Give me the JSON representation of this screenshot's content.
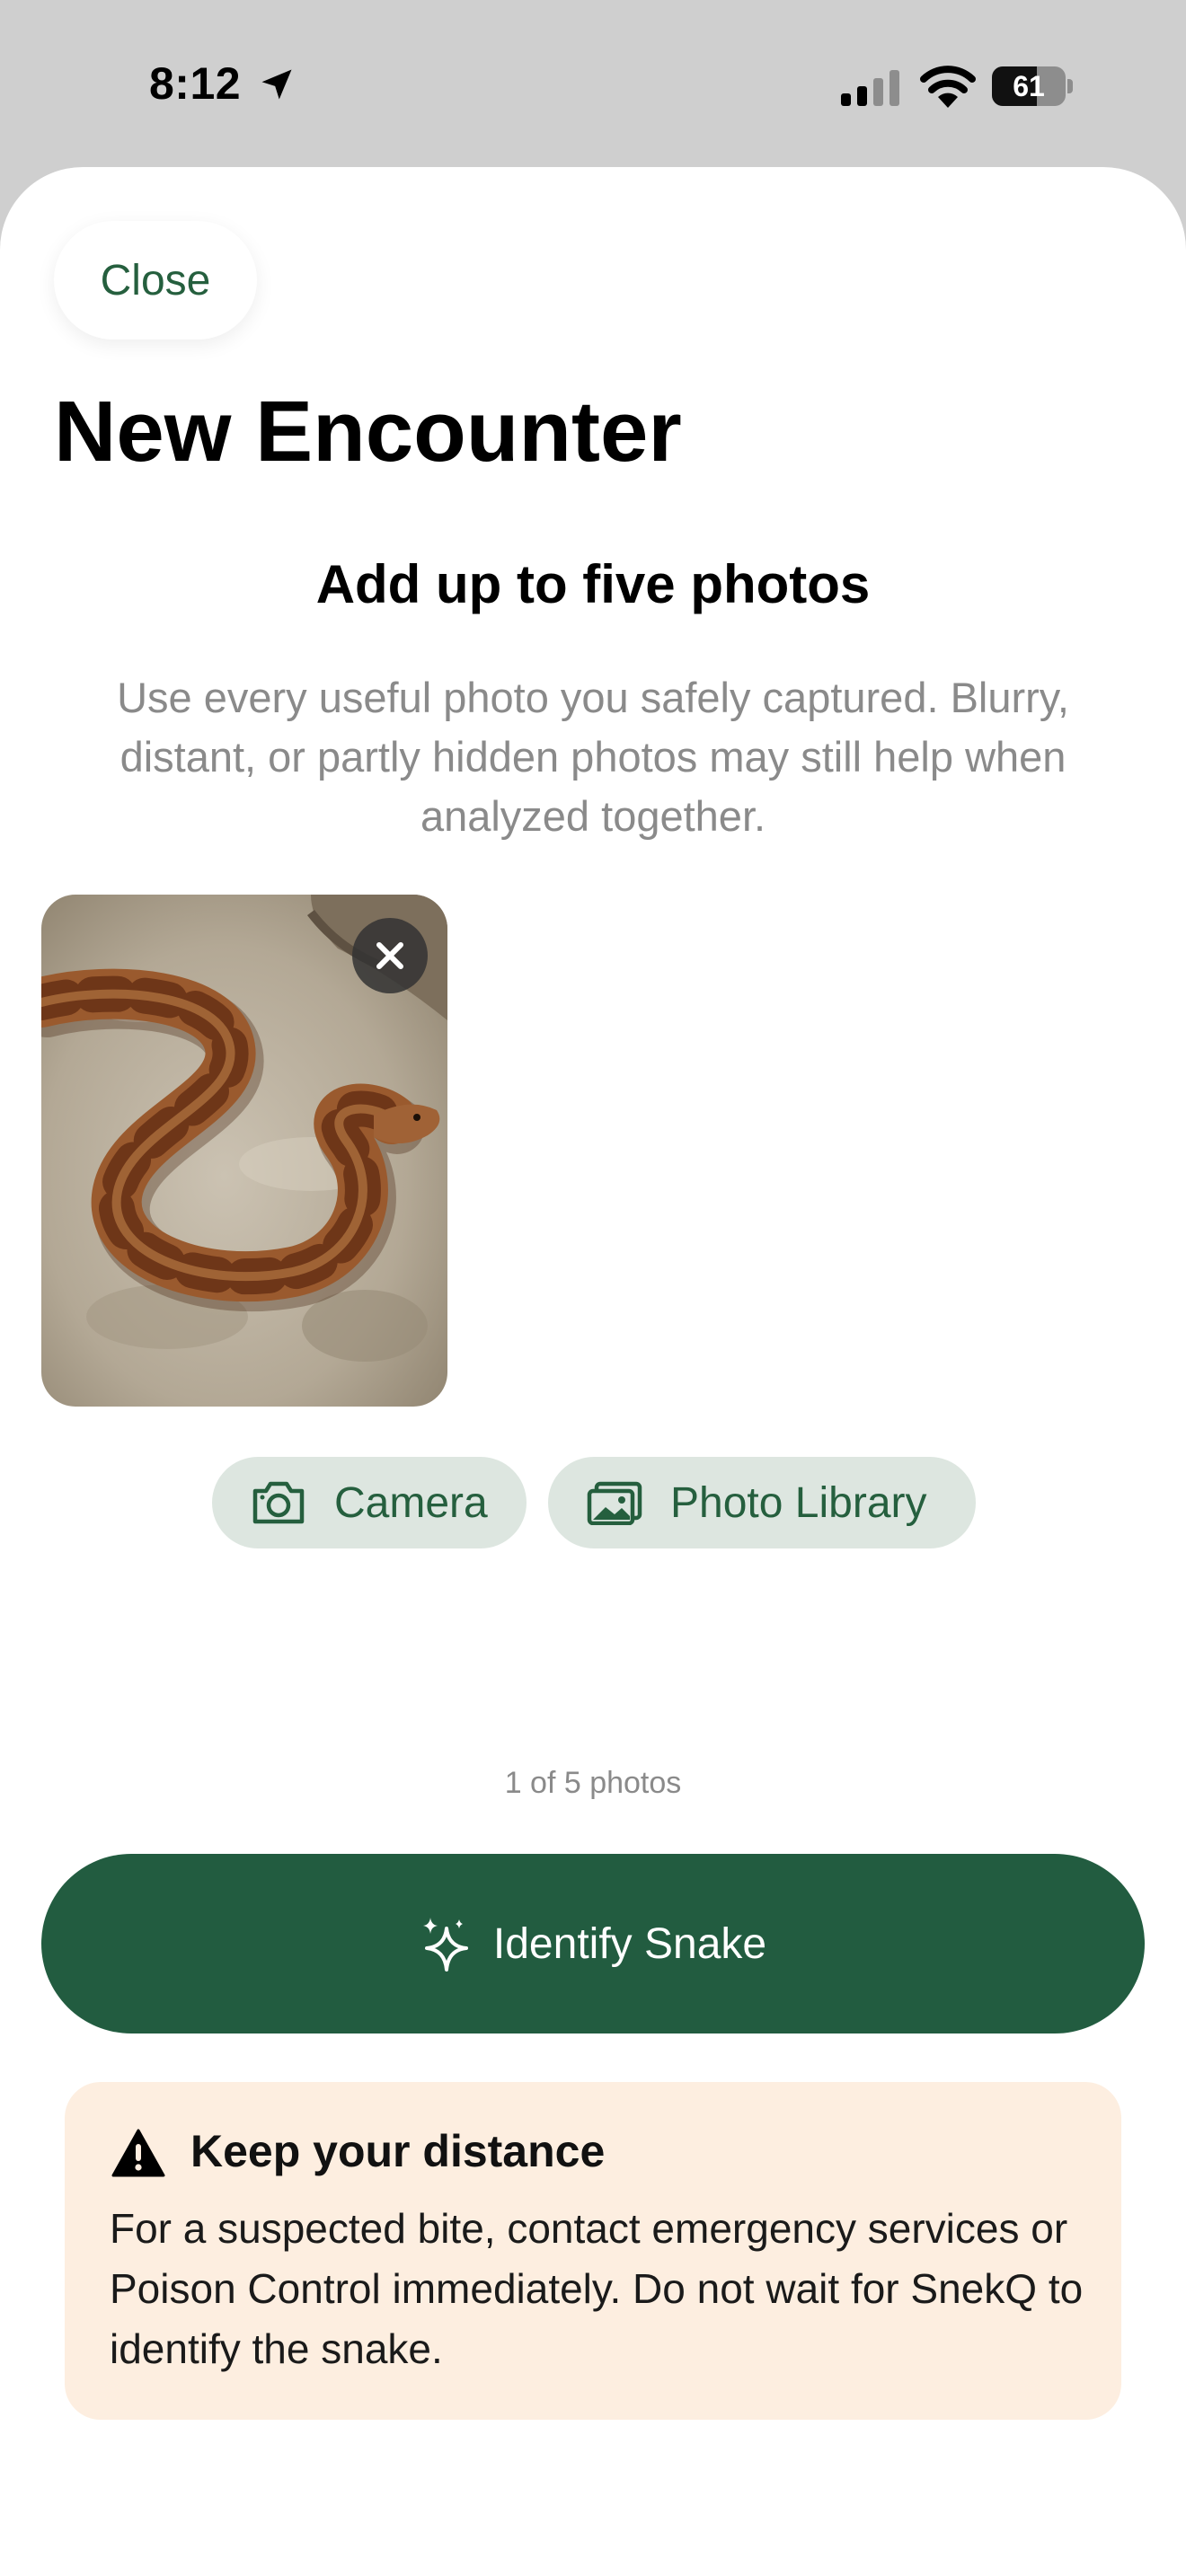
{
  "status_bar": {
    "time": "8:12",
    "battery_level": "61",
    "icons": [
      "location-arrow-icon",
      "cellular-signal-icon",
      "wifi-icon",
      "battery-icon"
    ]
  },
  "sheet": {
    "close_label": "Close",
    "title": "New Encounter"
  },
  "photos": {
    "heading": "Add up to five photos",
    "description": "Use every useful photo you safely captured. Blurry, distant, or partly hidden photos may still help when analyzed together.",
    "count_text": "1 of 5 photos",
    "count": 1,
    "max": 5
  },
  "actions": {
    "camera_label": "Camera",
    "library_label": "Photo Library",
    "identify_label": "Identify Snake"
  },
  "warning": {
    "title": "Keep your distance",
    "body": "For a suspected bite, contact emergency services or Poison Control immediately. Do not wait for SnekQ to identify the snake."
  },
  "colors": {
    "accent": "#225c40",
    "pill_background": "#dde6e0",
    "warning_background": "#fdeee0",
    "secondary_text": "#8a8a8a"
  }
}
